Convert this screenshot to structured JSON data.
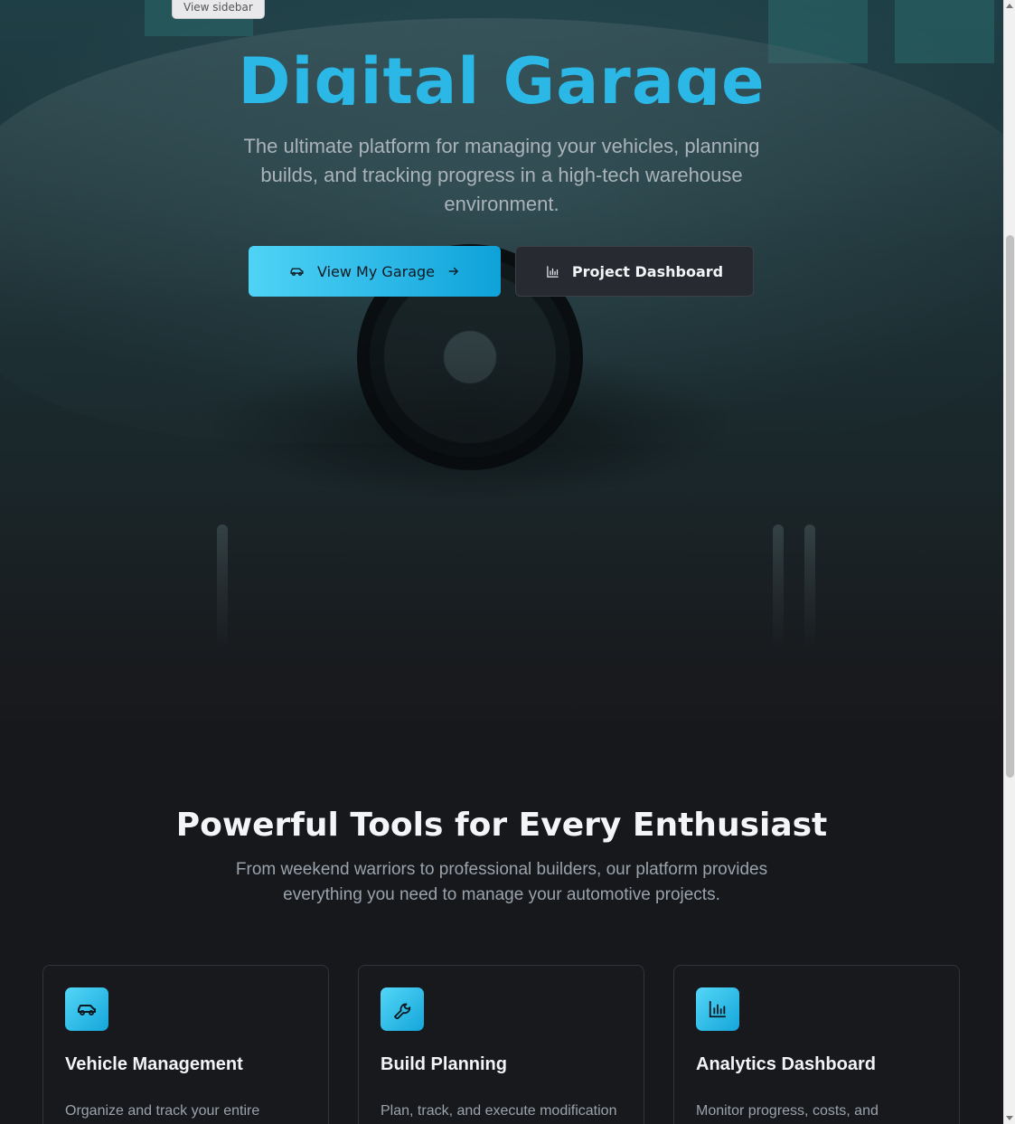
{
  "tooltip": "View sidebar",
  "hero": {
    "title": "Digital Garage",
    "subtitle": "The ultimate platform for managing your vehicles, planning builds, and tracking progress in a high-tech warehouse environment.",
    "primary_button": {
      "label": "View My Garage",
      "icon": "car-icon",
      "trailing_icon": "arrow-right-icon"
    },
    "secondary_button": {
      "label": "Project Dashboard",
      "icon": "bar-chart-icon"
    }
  },
  "features": {
    "title": "Powerful Tools for Every Enthusiast",
    "subtitle": "From weekend warriors to professional builders, our platform provides everything you need to manage your automotive projects.",
    "cards": [
      {
        "icon": "car-icon",
        "title": "Vehicle Management",
        "description": "Organize and track your entire"
      },
      {
        "icon": "wrench-icon",
        "title": "Build Planning",
        "description": "Plan, track, and execute modification"
      },
      {
        "icon": "bar-chart-icon",
        "title": "Analytics Dashboard",
        "description": "Monitor progress, costs, and"
      }
    ]
  },
  "colors": {
    "accent": "#29b6e6",
    "background": "#17181c",
    "card_border": "#30343b"
  }
}
